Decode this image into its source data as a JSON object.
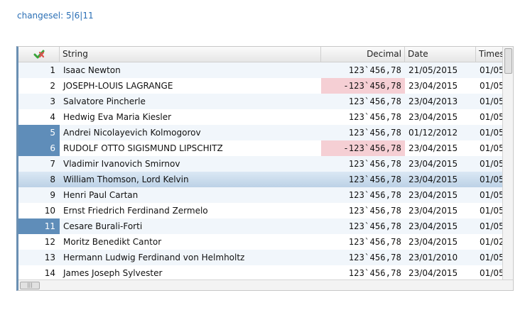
{
  "changesel": "changesel: 5|6|11",
  "header": {
    "icon": "green-red-check-icon",
    "columns": [
      "String",
      "Decimal",
      "Date",
      "Times"
    ]
  },
  "rows": [
    {
      "num": "1",
      "string": "Isaac Newton",
      "decimal": "123`456,78",
      "date": "21/05/2015",
      "ts": "01/05"
    },
    {
      "num": "2",
      "string": "JOSEPH-LOUIS LAGRANGE",
      "decimal": "-123`456,78",
      "date": "23/04/2015",
      "ts": "01/05"
    },
    {
      "num": "3",
      "string": "Salvatore Pincherle",
      "decimal": "123`456,78",
      "date": "23/04/2013",
      "ts": "01/05"
    },
    {
      "num": "4",
      "string": "Hedwig Eva Maria Kiesler",
      "decimal": "123`456,78",
      "date": "23/04/2015",
      "ts": "01/05"
    },
    {
      "num": "5",
      "string": "Andrei Nicolayevich Kolmogorov",
      "decimal": "123`456,78",
      "date": "01/12/2012",
      "ts": "01/05"
    },
    {
      "num": "6",
      "string": "RUDOLF OTTO SIGISMUND LIPSCHITZ",
      "decimal": "-123`456,78",
      "date": "23/04/2015",
      "ts": "01/05"
    },
    {
      "num": "7",
      "string": "Vladimir Ivanovich Smirnov",
      "decimal": "123`456,78",
      "date": "23/04/2015",
      "ts": "01/05"
    },
    {
      "num": "8",
      "string": "William Thomson, Lord Kelvin",
      "decimal": "123`456,78",
      "date": "23/04/2015",
      "ts": "01/05"
    },
    {
      "num": "9",
      "string": "Henri Paul Cartan",
      "decimal": "123`456,78",
      "date": "23/04/2015",
      "ts": "01/05"
    },
    {
      "num": "10",
      "string": "Ernst Friedrich Ferdinand Zermelo",
      "decimal": "123`456,78",
      "date": "23/04/2015",
      "ts": "01/05"
    },
    {
      "num": "11",
      "string": "Cesare Burali-Forti",
      "decimal": "123`456,78",
      "date": "23/04/2015",
      "ts": "01/05"
    },
    {
      "num": "12",
      "string": "Moritz Benedikt Cantor",
      "decimal": "123`456,78",
      "date": "23/04/2015",
      "ts": "01/02"
    },
    {
      "num": "13",
      "string": "Hermann Ludwig Ferdinand von Helmholtz",
      "decimal": "123`456,78",
      "date": "23/01/2010",
      "ts": "01/05"
    },
    {
      "num": "14",
      "string": "James Joseph Sylvester",
      "decimal": "123`456,78",
      "date": "23/04/2015",
      "ts": "01/05"
    }
  ],
  "colors": {
    "selected": "#5f8db9",
    "negative": "#f5cfd4",
    "link": "#2a6fb5"
  }
}
